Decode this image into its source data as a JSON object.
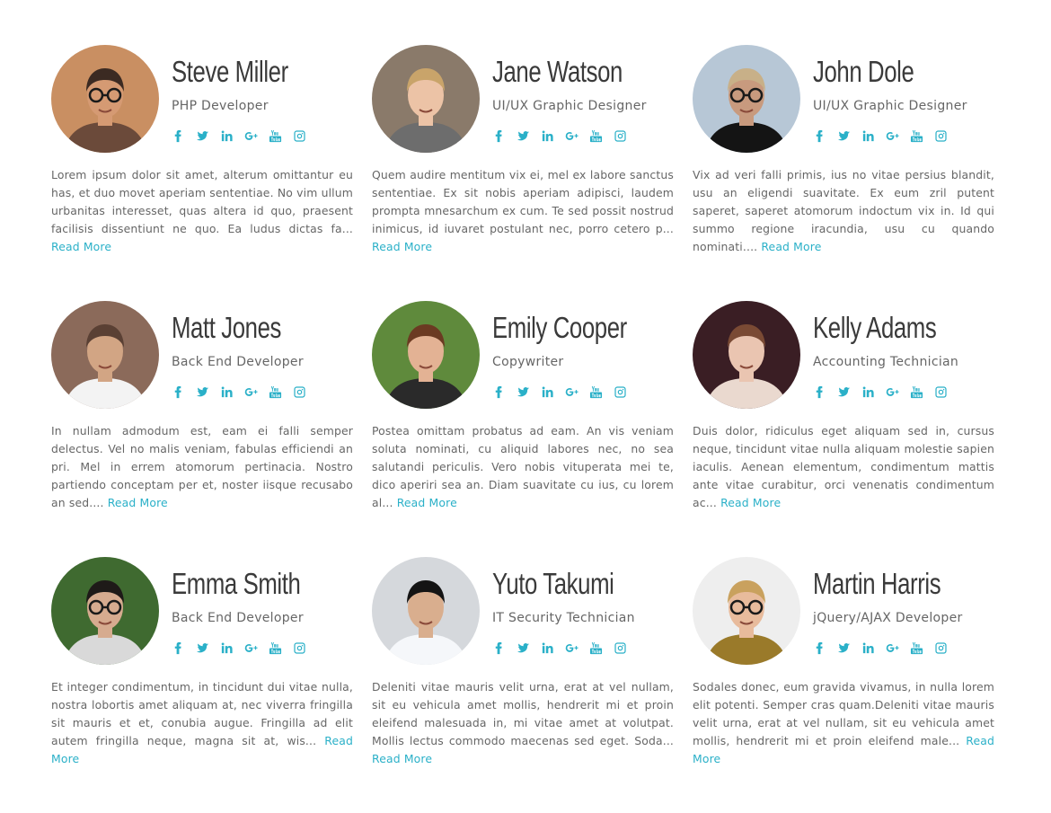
{
  "accent": "#2ab0c8",
  "social_icons": [
    "facebook-icon",
    "twitter-icon",
    "linkedin-icon",
    "google-plus-icon",
    "youtube-icon",
    "instagram-icon"
  ],
  "read_more_label": "Read More",
  "members": [
    {
      "name": "Steve Miller",
      "role": "PHP Developer",
      "bio": "Lorem ipsum dolor sit amet, alterum omittantur eu has, et duo movet aperiam sententiae. No vim ullum urbanitas interesset, quas altera id quo, praesent facilisis dissentiunt ne quo. Ea ludus dictas fa...",
      "photo": {
        "bg": "#c98f62",
        "skin": "#d59a73",
        "hair": "#3b2a22",
        "shirt": "#6b4a3a",
        "glasses": true
      }
    },
    {
      "name": "Jane Watson",
      "role": "UI/UX Graphic Designer",
      "bio": "Quem audire mentitum vix ei, mel ex labore sanctus sententiae. Ex sit nobis aperiam adipisci, laudem prompta mnesarchum ex cum. Te sed possit nostrud inimicus, id iuvaret postulant nec, porro cetero p...",
      "photo": {
        "bg": "#8a7a6a",
        "skin": "#ecc3a6",
        "hair": "#c9a46a",
        "shirt": "#6d6d6d",
        "glasses": false
      }
    },
    {
      "name": "John Dole",
      "role": "UI/UX Graphic Designer",
      "bio": "Vix ad veri falli primis, ius no vitae persius blandit, usu an eligendi suavitate. Ex eum zril putent saperet, saperet atomorum indoctum vix in. Id qui summo regione iracundia, usu cu quando nominati....",
      "photo": {
        "bg": "#b7c7d6",
        "skin": "#c89a7e",
        "hair": "#c8b088",
        "shirt": "#141414",
        "glasses": true
      }
    },
    {
      "name": "Matt Jones",
      "role": "Back End Developer",
      "bio": "In nullam admodum est, eam ei falli semper delectus. Vel no malis veniam, fabulas efficiendi an pri. Mel in errem atomorum pertinacia. Nostro partiendo conceptam per et, noster iisque recusabo an sed....",
      "photo": {
        "bg": "#8b6a5a",
        "skin": "#d2a584",
        "hair": "#5a4034",
        "shirt": "#f3f3f3",
        "glasses": false
      }
    },
    {
      "name": "Emily Cooper",
      "role": "Copywriter",
      "bio": "Postea omittam probatus ad eam. An vis veniam soluta nominati, cu aliquid labores nec, no sea salutandi periculis. Vero nobis vituperata mei te, dico aperiri sea an. Diam suavitate cu ius, cu lorem al...",
      "photo": {
        "bg": "#5f8a3c",
        "skin": "#e3b294",
        "hair": "#6b3a22",
        "shirt": "#2a2a2a",
        "glasses": false
      }
    },
    {
      "name": "Kelly Adams",
      "role": "Accounting Technician",
      "bio": "Duis dolor, ridiculus eget aliquam sed in, cursus neque, tincidunt vitae nulla aliquam molestie sapien iaculis. Aenean elementum, condimentum mattis ante vitae curabitur, orci venenatis condimentum ac...",
      "photo": {
        "bg": "#3a1e24",
        "skin": "#eac5b1",
        "hair": "#7a4a34",
        "shirt": "#ead9cf",
        "glasses": false
      }
    },
    {
      "name": "Emma Smith",
      "role": "Back End Developer",
      "bio": "Et integer condimentum, in tincidunt dui vitae nulla, nostra lobortis amet aliquam at, nec viverra fringilla sit mauris et et, conubia augue. Fringilla ad elit autem fringilla neque, magna sit at, wis...",
      "photo": {
        "bg": "#3f6a30",
        "skin": "#d6ab8f",
        "hair": "#1e1a18",
        "shirt": "#d9d9d9",
        "glasses": true
      }
    },
    {
      "name": "Yuto Takumi",
      "role": "IT Security Technician",
      "bio": "Deleniti vitae mauris velit urna, erat at vel nullam, sit eu vehicula amet mollis, hendrerit mi et proin eleifend malesuada in, mi vitae amet at volutpat. Mollis lectus commodo maecenas sed eget. Soda...",
      "photo": {
        "bg": "#d5d8dc",
        "skin": "#d9ae8e",
        "hair": "#141414",
        "shirt": "#f5f7fa",
        "glasses": false
      }
    },
    {
      "name": "Martin Harris",
      "role": "jQuery/AJAX Developer",
      "bio": "Sodales donec, eum gravida vivamus, in nulla lorem elit potenti. Semper cras quam.Deleniti vitae mauris velit urna, erat at vel nullam, sit eu vehicula amet mollis, hendrerit mi et proin eleifend male...",
      "photo": {
        "bg": "#eeeeee",
        "skin": "#e8bb9c",
        "hair": "#c9a15e",
        "shirt": "#9a7a2a",
        "glasses": true
      }
    }
  ]
}
